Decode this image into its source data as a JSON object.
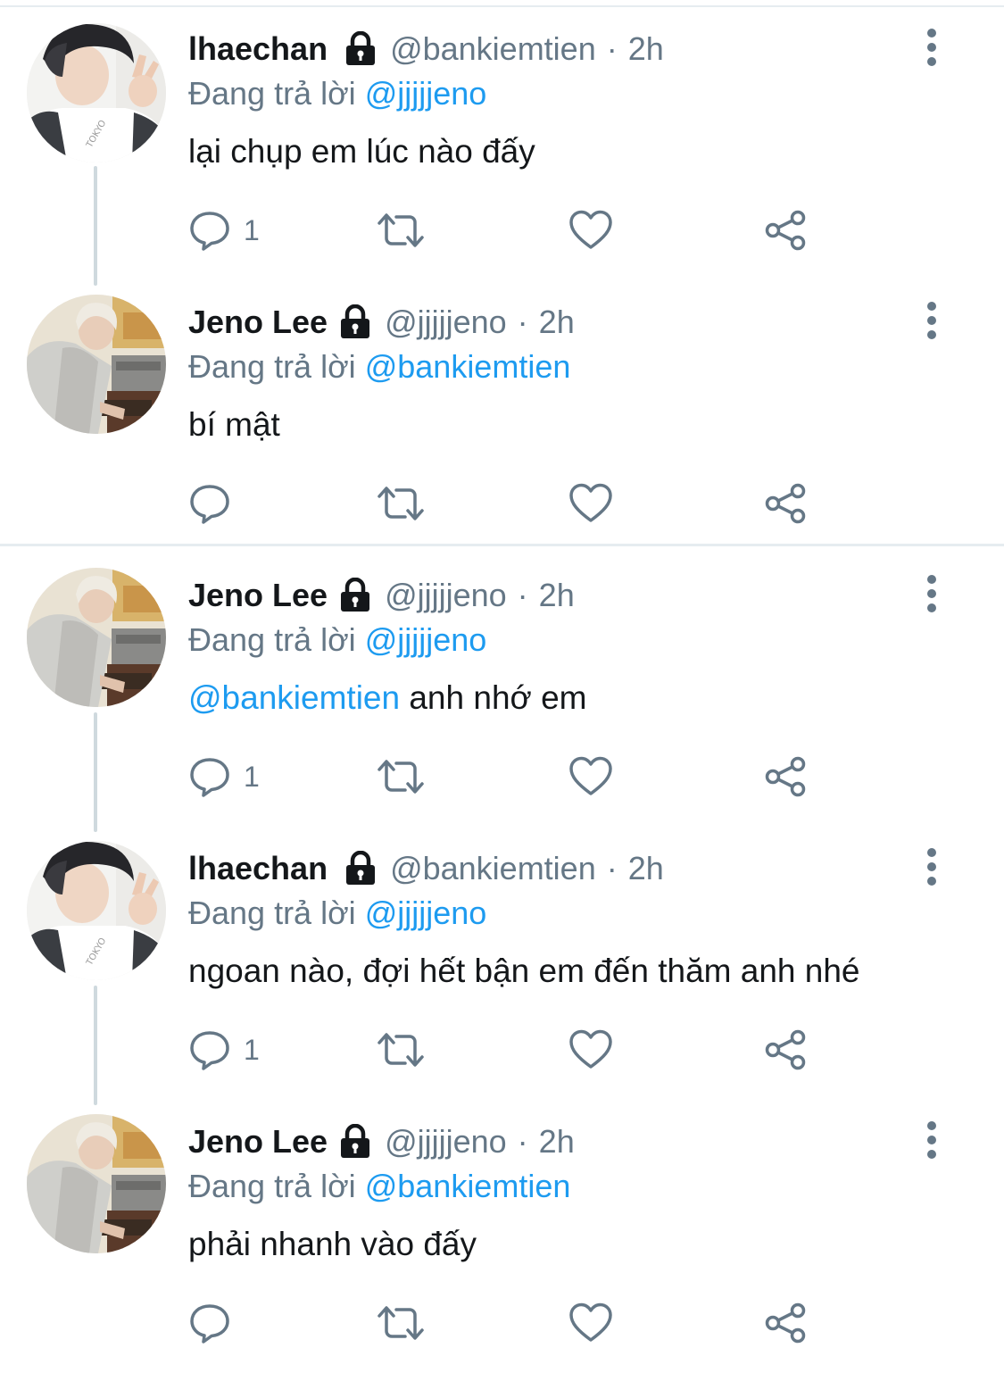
{
  "reply_prefix": "Đang trả lời",
  "tweets": [
    {
      "name": "lhaechan",
      "handle": "@bankiemtien",
      "dot": "·",
      "time": "2h",
      "reply_to": "@jjjjjeno",
      "text_mention": "",
      "text": "lại chụp em lúc nào đấy",
      "reply_count": "1",
      "avatar": "lhaechan-avatar"
    },
    {
      "name": "Jeno Lee",
      "handle": "@jjjjjeno",
      "dot": "·",
      "time": "2h",
      "reply_to": "@bankiemtien",
      "text_mention": "",
      "text": "bí mật",
      "reply_count": "",
      "avatar": "jeno-avatar"
    },
    {
      "name": "Jeno Lee",
      "handle": "@jjjjjeno",
      "dot": "·",
      "time": "2h",
      "reply_to": "@jjjjjeno",
      "text_mention": "@bankiemtien",
      "text": " anh nhớ em",
      "reply_count": "1",
      "avatar": "jeno-avatar"
    },
    {
      "name": "lhaechan",
      "handle": "@bankiemtien",
      "dot": "·",
      "time": "2h",
      "reply_to": "@jjjjjeno",
      "text_mention": "",
      "text": "ngoan nào, đợi hết bận em đến thăm anh nhé",
      "reply_count": "1",
      "avatar": "lhaechan-avatar"
    },
    {
      "name": "Jeno Lee",
      "handle": "@jjjjjeno",
      "dot": "·",
      "time": "2h",
      "reply_to": "@bankiemtien",
      "text_mention": "",
      "text": "phải nhanh vào đấy",
      "reply_count": "",
      "avatar": "jeno-avatar"
    }
  ],
  "colors": {
    "text": "#14171a",
    "secondary": "#657786",
    "mention": "#1d9bf0",
    "divider": "#e6ecf0",
    "thread_line": "#cfd9de"
  },
  "icons": [
    "lock-icon",
    "more-icon",
    "reply-icon",
    "retweet-icon",
    "like-icon",
    "share-icon"
  ]
}
